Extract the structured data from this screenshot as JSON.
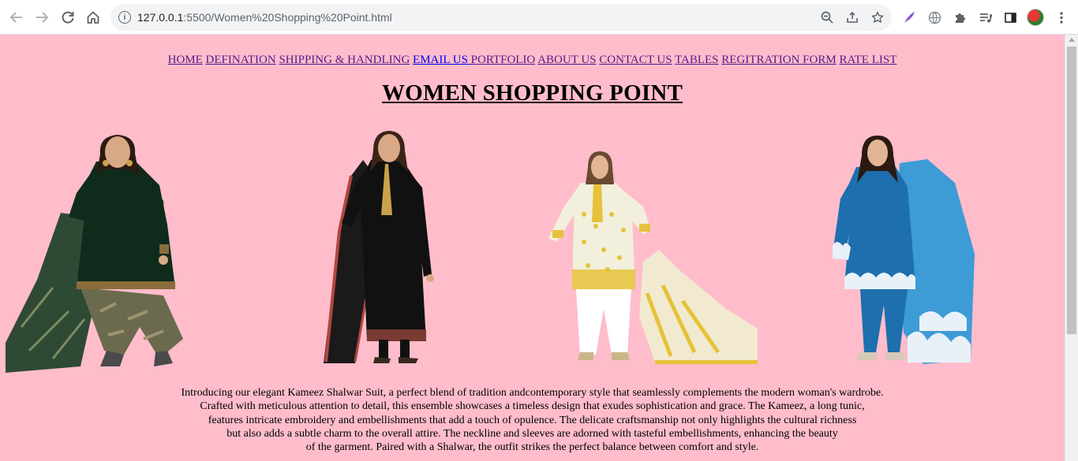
{
  "browser": {
    "url_host": "127.0.0.1",
    "url_path": ":5500/Women%20Shopping%20Point.html",
    "icons": {
      "back": "arrow-left-icon",
      "forward": "arrow-right-icon",
      "reload": "reload-icon",
      "home": "home-icon",
      "site_info": "info-icon",
      "zoom": "zoom-out-icon",
      "share": "share-icon",
      "bookmark": "star-icon",
      "extension_feather": "feather-icon",
      "extension_globe": "globe-icon",
      "extensions": "puzzle-icon",
      "media": "media-queue-icon",
      "side_panel": "side-panel-icon",
      "profile": "avatar-icon",
      "menu": "kebab-menu-icon"
    }
  },
  "nav": [
    {
      "label": "HOME"
    },
    {
      "label": "DEFINATION"
    },
    {
      "label": "SHIPPING & HANDLING"
    },
    {
      "label": "EMAIL US "
    },
    {
      "label": "PORTFOLIO"
    },
    {
      "label": "ABOUT US"
    },
    {
      "label": "CONTACT US"
    },
    {
      "label": "TABLES"
    },
    {
      "label": "REGITRATION FORM"
    },
    {
      "label": "RATE LIST"
    }
  ],
  "title": "WOMEN SHOPPING POINT",
  "products": [
    {
      "name": "dark green printed patiala suit",
      "colors": {
        "kameez": "#0f2b1c",
        "shalwar": "#6b6a4e",
        "dupatta": "#2f4a34"
      }
    },
    {
      "name": "black embroidered long kameez",
      "colors": {
        "kameez": "#111111",
        "trim": "#b2463f",
        "dupatta": "#1a1a1a"
      }
    },
    {
      "name": "ivory and yellow printed suit",
      "colors": {
        "kameez": "#f2f0dc",
        "trim": "#e6c23a",
        "shalwar": "#ffffff"
      }
    },
    {
      "name": "blue organza lace suit",
      "colors": {
        "kameez": "#1d6fae",
        "dupatta": "#3d9bd6",
        "lace": "#e8f1f8"
      }
    }
  ],
  "description": [
    "Introducing our elegant Kameez Shalwar Suit, a perfect blend of tradition andcontemporary style that seamlessly complements the modern woman's wardrobe.",
    "Crafted with meticulous attention to detail, this ensemble showcases a timeless design that exudes sophistication and grace. The Kameez, a long tunic,",
    "features intricate embroidery and embellishments that add a touch of opulence. The delicate craftsmanship not only highlights the cultural richness",
    "but also adds a subtle charm to the overall attire. The neckline and sleeves are adorned with tasteful embellishments, enhancing the beauty",
    "of the garment. Paired with a Shalwar, the outfit strikes the perfect balance between comfort and style."
  ],
  "colors": {
    "page_background": "#ffbdcb",
    "visited_link": "#551a8b",
    "unvisited_link": "#0000ee"
  }
}
